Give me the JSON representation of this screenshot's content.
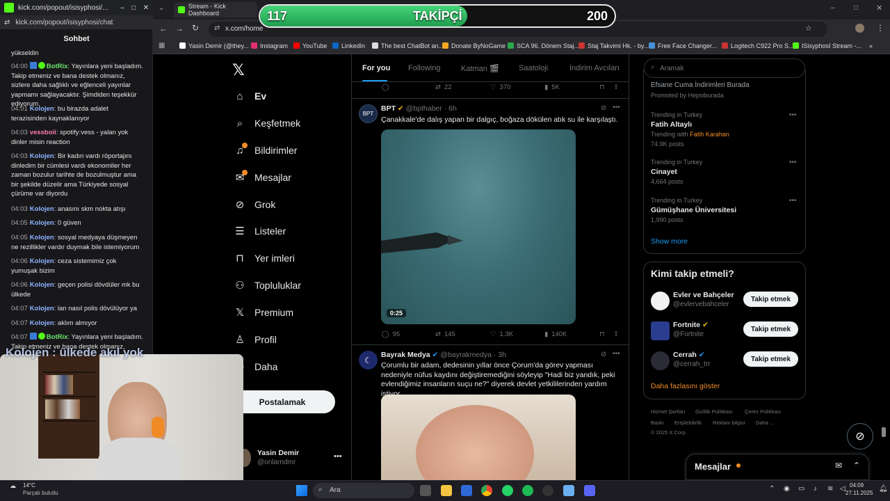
{
  "chat": {
    "window_title": "kick.com/popout/isisyphosi/...",
    "url": "kick.com/popout/isisyphosi/chat",
    "header": "Sohbet",
    "prev_fragment": "yükseldin",
    "messages": [
      {
        "time": "04:00",
        "user": "BotRix",
        "type": "bot",
        "text": "Yayınlara yeni başladım. Takip etmeniz ve bana destek olmanız, sizlere daha sağlıklı ve eğlenceli yayınlar yapmamı sağlayacaktır. Şimdiden teşekkür ediyorum."
      },
      {
        "time": "04:01",
        "user": "Kolojen",
        "type": "kol",
        "text": "bu birazda adalet terazisinden kaynaklanıyor"
      },
      {
        "time": "04:03",
        "user": "vessboii",
        "type": "vess",
        "text": "spotify:vess - yalan yok dinler misin reaction"
      },
      {
        "time": "04:03",
        "user": "Kolojen",
        "type": "kol",
        "text": "Bir kadın vardı röportajını dinledim bir cümlesi vardı ekonomiler her zaman bozulur tarihte de bozulmuştur ama bir şekilde düzelir ama Türkiyede sosyal çürüme var diyordu"
      },
      {
        "time": "04:03",
        "user": "Kolojen",
        "type": "kol",
        "text": "anasını skm nokta atışı"
      },
      {
        "time": "04:05",
        "user": "Kolojen",
        "type": "kol",
        "text": "0 güven"
      },
      {
        "time": "04:05",
        "user": "Kolojen",
        "type": "kol",
        "text": "sosyal medyaya düşmeyen ne rezillikler vardır duymak bile istemiyorum"
      },
      {
        "time": "04:06",
        "user": "Kolojen",
        "type": "kol",
        "text": "ceza sistemimiz çok yumuşak bizim"
      },
      {
        "time": "04:06",
        "user": "Kolojen",
        "type": "kol",
        "text": "geçen polisi dövdüler mk bu ülkede"
      },
      {
        "time": "04:07",
        "user": "Kolojen",
        "type": "kol",
        "text": "lan nasıl polis dövülüyor ya"
      },
      {
        "time": "04:07",
        "user": "Kolojen",
        "type": "kol",
        "text": "aklım almıyor"
      },
      {
        "time": "04:07",
        "user": "BotRix",
        "type": "bot",
        "text": "Yayınlara yeni başladım. Takip etmeniz ve bana destek olmanız, sizlere"
      }
    ],
    "overlay_text": "Kolojen : ülkede akıl yok"
  },
  "browser": {
    "tab_title": "Stream - Kick Dashboard",
    "url": "x.com/home",
    "bookmarks": [
      "Yasin Demir (@they...",
      "Instagram",
      "YouTube",
      "LinkedIn",
      "The best ChatBot an...",
      "Donate ByNoGame",
      "SCA 96. Dönem Staj...",
      "Staj Takvimi Hk. - by...",
      "Free Face Changer...",
      "Logitech C922 Pro S...",
      "ISisyphosI Stream -..."
    ]
  },
  "follow_goal": {
    "current": "117",
    "label": "TAKİPÇİ",
    "target": "200",
    "progress": 0.585
  },
  "nav": {
    "items": [
      {
        "label": "Ev",
        "icon": "home-icon"
      },
      {
        "label": "Keşfetmek",
        "icon": "search-icon"
      },
      {
        "label": "Bildirimler",
        "icon": "bell-icon"
      },
      {
        "label": "Mesajlar",
        "icon": "mail-icon"
      },
      {
        "label": "Grok",
        "icon": "grok-icon"
      },
      {
        "label": "Listeler",
        "icon": "list-icon"
      },
      {
        "label": "Yer imleri",
        "icon": "bookmark-icon"
      },
      {
        "label": "Topluluklar",
        "icon": "community-icon"
      },
      {
        "label": "Premium",
        "icon": "x-icon"
      },
      {
        "label": "Profil",
        "icon": "person-icon"
      },
      {
        "label": "Daha",
        "icon": "more-icon"
      }
    ],
    "post_button": "Postalamak",
    "account_name": "Yasin Demir",
    "account_handle": "@onlarndmr"
  },
  "feed": {
    "tabs": [
      "For you",
      "Following",
      "Katman 🎬",
      "Saatoloji",
      "İndirim Avcıları"
    ],
    "top_metrics": {
      "retweets": "22",
      "likes": "370",
      "views": "5K"
    },
    "posts": [
      {
        "author": "BPT",
        "handle": "@bpthaber",
        "time": "6h",
        "text": "Çanakkale'de dalış yapan bir dalgıç, boğaza dökülen atık su ile karşılaştı.",
        "video_duration": "0:25",
        "replies": "95",
        "retweets": "145",
        "likes": "1.3K",
        "views": "140K"
      },
      {
        "author": "Bayrak Medya",
        "handle": "@bayrakmedya",
        "time": "3h",
        "text": "Çorumlu bir adam, dedesinin yıllar önce Çorum'da görev yapması nedeniyle nüfus kaydını değiştiremediğini söyleyip \"Hadi biz yandık, peki evlendiğimiz insanların suçu ne?\" diyerek devlet yetkililerinden yardım istiyor."
      }
    ]
  },
  "right": {
    "search_placeholder": "Aramak",
    "promo_title": "Efsane Cuma İndirimleri Burada",
    "promo_sub": "Promoted by Hepsiburada",
    "trends": [
      {
        "context": "Trending in Turkey",
        "title": "Fatih Altaylı",
        "with_label": "Trending with",
        "with": "Fatih Karahan",
        "posts": "74.9K posts"
      },
      {
        "context": "Trending in Turkey",
        "title": "Cinayet",
        "posts": "4,664 posts"
      },
      {
        "context": "Trending in Turkey",
        "title": "Gümüşhane Üniversitesi",
        "posts": "1,990 posts"
      }
    ],
    "show_more": "Show more",
    "who_to_follow_title": "Kimi takip etmeli?",
    "suggestions": [
      {
        "name": "Evler ve Bahçeler",
        "handle": "@evlervebahceler",
        "button": "Takip etmek"
      },
      {
        "name": "Fortnite",
        "handle": "@Fortnite",
        "button": "Takip etmek"
      },
      {
        "name": "Cerrah",
        "handle": "@cerrah_trr",
        "button": "Takip etmek"
      }
    ],
    "show_more_follow": "Daha fazlasını göster",
    "footer": [
      "Hizmet Şartları",
      "Gizlilik Politikası",
      "Çerez Politikası",
      "Baskı",
      "Erişilebilirlik",
      "Reklam bilgisi",
      "Daha ...",
      "© 2025 X Corp."
    ],
    "messages_label": "Mesajlar"
  },
  "taskbar": {
    "weather_temp": "14°C",
    "weather_text": "Parçalı bulutlu",
    "search": "Ara",
    "time": "04:09",
    "date": "27.11.2025"
  }
}
